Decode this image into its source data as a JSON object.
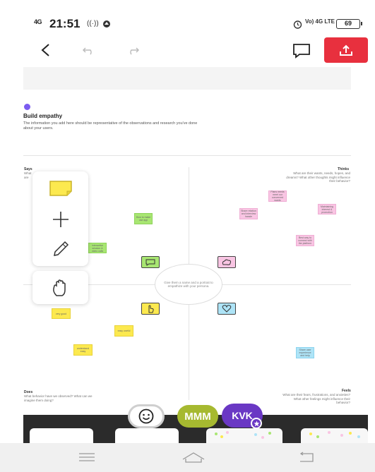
{
  "status_bar": {
    "signal": "4G",
    "time": "21:51",
    "volte": "Vo) 4G LTE",
    "battery": "69"
  },
  "canvas": {
    "section_title": "Build empathy",
    "section_description": "The information you add here should be representative of the observations and research you've done about your users.",
    "quadrants": {
      "says": {
        "label": "Says",
        "sub": "What are some quotes and defining words your user said?"
      },
      "thinks": {
        "label": "Thinks",
        "sub": "What are their wants, needs, hopes, and dreams? What other thoughts might influence their behavior?"
      },
      "does": {
        "label": "Does",
        "sub": "What behavior have we observed? What can we imagine them doing?"
      },
      "feels": {
        "label": "Feels",
        "sub": "What are their fears, frustrations, and anxieties? What other feelings might influence their behavior?"
      }
    },
    "center_text": "Give them a name and a portrait to empathize with your persona.",
    "notes": [
      {
        "text": "How to make use app"
      },
      {
        "text": "Interactive session & video calls"
      },
      {
        "text": "Plans needs meet our concerned wants"
      },
      {
        "text": "Share relation and interview hassle"
      },
      {
        "text": "Maintaining interest & promotion"
      },
      {
        "text": "Best way to connect with the platform"
      },
      {
        "text": "very good"
      },
      {
        "text": "easy useful"
      },
      {
        "text": "understand easy"
      },
      {
        "text": "Share user experience and help"
      }
    ]
  },
  "participants": {
    "user1": "MMM",
    "user2": "KVK"
  },
  "colors": {
    "accent": "#e8303e",
    "sticky_yellow": "#fce94f",
    "sticky_green": "#a8e672",
    "sticky_pink": "#f9c5e3",
    "sticky_blue": "#aee4f7",
    "avatar_mmm": "#a6b930",
    "avatar_kvk": "#6a38c4"
  }
}
